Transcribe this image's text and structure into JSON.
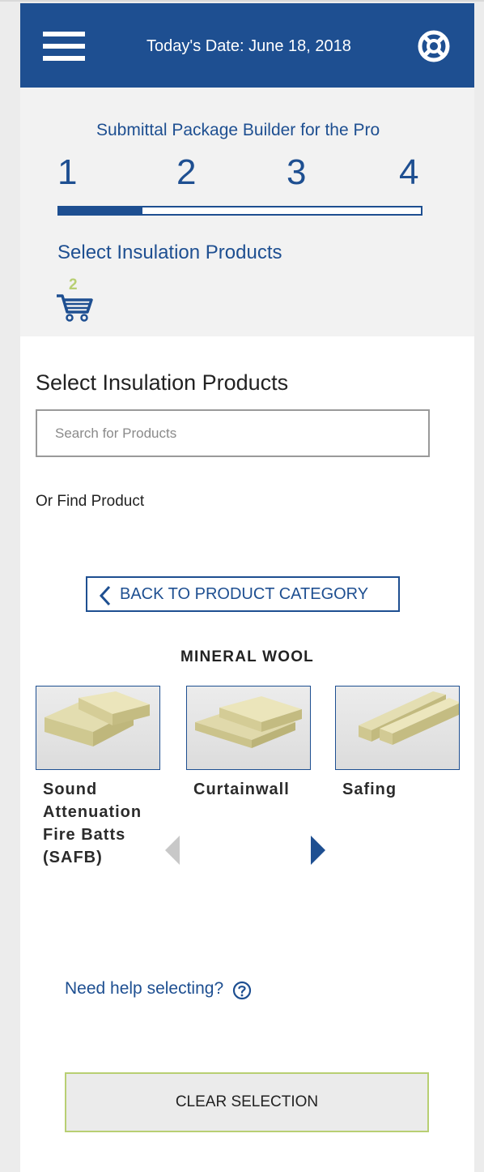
{
  "header": {
    "date_text": "Today's Date: June 18, 2018",
    "menu_icon": "hamburger-icon",
    "help_icon": "lifebuoy-icon",
    "background": "#1e4f91"
  },
  "builder": {
    "title": "Submittal Package Builder for the Pro",
    "steps": [
      "1",
      "2",
      "3",
      "4"
    ],
    "progress_percent": 23,
    "heading": "Select Insulation Products",
    "cart_count": "2",
    "cart_icon": "shopping-cart-icon"
  },
  "main": {
    "title": "Select Insulation Products",
    "search_placeholder": "Search for Products",
    "find_label": "Or Find Product",
    "back_button": "BACK TO PRODUCT CATEGORY",
    "category": "MINERAL WOOL",
    "products": [
      {
        "label": "Sound Attenuation Fire Batts (SAFB)"
      },
      {
        "label": "Curtainwall"
      },
      {
        "label": "Safing"
      }
    ],
    "need_help": "Need help selecting?",
    "clear_button": "CLEAR SELECTION"
  },
  "colors": {
    "brand_blue": "#1e4f91",
    "accent_green": "#b8cf73",
    "panel_grey": "#f2f2f2"
  }
}
